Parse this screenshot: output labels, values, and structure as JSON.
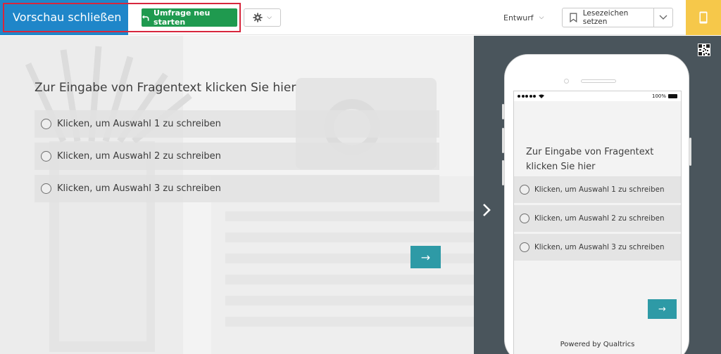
{
  "topbar": {
    "close_preview": "Vorschau schließen",
    "restart_survey": "Umfrage neu starten",
    "status": "Entwurf",
    "bookmark": "Lesezeichen setzen"
  },
  "survey": {
    "question": "Zur Eingabe von Fragentext klicken Sie hier",
    "choices": [
      "Klicken, um Auswahl 1 zu schreiben",
      "Klicken, um Auswahl 2 zu schreiben",
      "Klicken, um Auswahl 3 zu schreiben"
    ],
    "next_label": "→"
  },
  "mobile": {
    "battery": "100%",
    "question": "Zur Eingabe von Fragentext klicken Sie hier",
    "choices": [
      "Klicken, um Auswahl 1 zu schreiben",
      "Klicken, um Auswahl 2 zu schreiben",
      "Klicken, um Auswahl 3 zu schreiben"
    ],
    "next_label": "→",
    "powered_by": "Powered by Qualtrics"
  },
  "colors": {
    "close_preview_bg": "#1f86c9",
    "restart_bg": "#1f9a4f",
    "highlight_outline": "#d7263d",
    "mobile_toggle_bg": "#f6c84a",
    "next_button": "#2e9aa6",
    "mobile_panel_bg": "#4a555c"
  },
  "icons": {
    "restart": "undo-arrow-icon",
    "settings": "gear-icon",
    "bookmark": "bookmark-icon",
    "mobile_toggle": "phone-icon",
    "collapse": "chevron-right-icon",
    "qr": "qr-code-icon"
  }
}
